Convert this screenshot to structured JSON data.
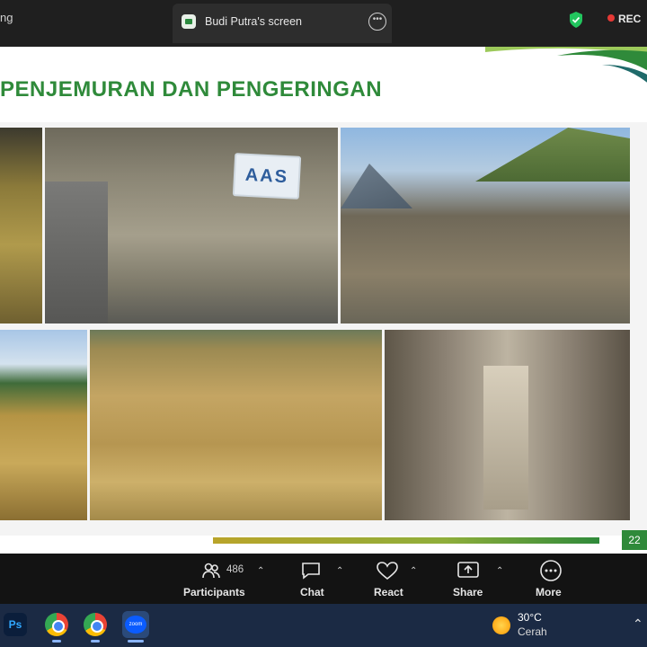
{
  "topbar": {
    "prev_tab_fragment": "ng",
    "active_tab_title": "Budi Putra's screen",
    "rec_label": "REC"
  },
  "slide": {
    "title": "PENJEMURAN DAN PENGERINGAN",
    "sign_text": "AAS",
    "page_number": "22",
    "colors": {
      "title_green": "#2f8a3a",
      "progress_start": "#b9a42a",
      "progress_end": "#2f8a3a"
    }
  },
  "controls": {
    "participants_count": "486",
    "participants_label": "Participants",
    "chat_label": "Chat",
    "react_label": "React",
    "share_label": "Share",
    "more_label": "More"
  },
  "taskbar": {
    "ps_label": "Ps",
    "weather_temp": "30°C",
    "weather_desc": "Cerah"
  }
}
